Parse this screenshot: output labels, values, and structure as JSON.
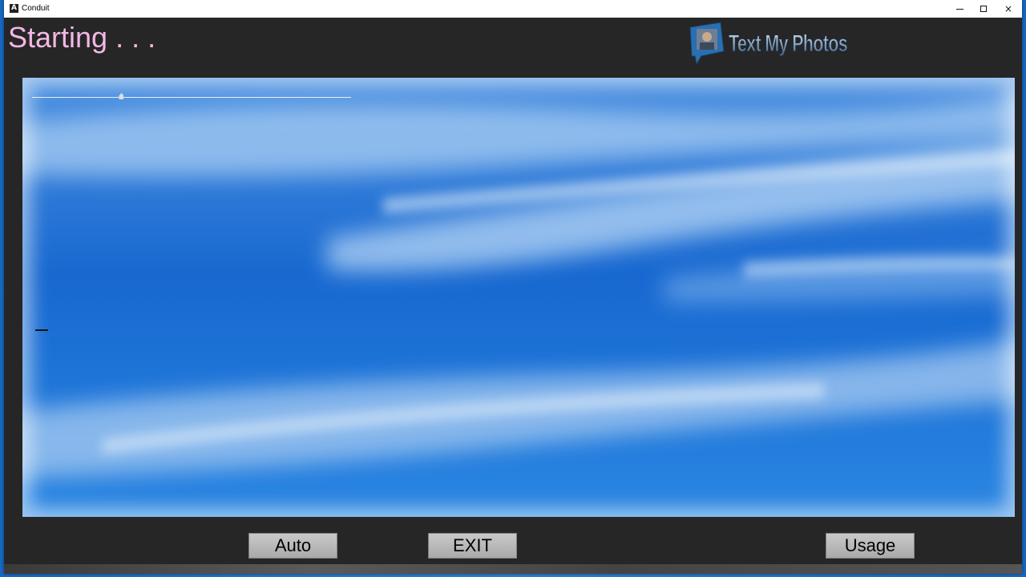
{
  "window": {
    "title": "Conduit",
    "app_icon_glyph": "A",
    "controls": {
      "minimize": "minimize-icon",
      "maximize": "maximize-icon",
      "close": "×"
    }
  },
  "status": {
    "text": "Starting . . .",
    "color": "#f3b8e4"
  },
  "logo": {
    "text": "Text My Photos"
  },
  "slider": {
    "value_fraction": 0.28
  },
  "buttons": {
    "auto": "Auto",
    "exit": "EXIT",
    "usage": "Usage"
  },
  "colors": {
    "window_bg": "#262626",
    "sky": "#1c72d6",
    "button": "#b9b9b9"
  }
}
